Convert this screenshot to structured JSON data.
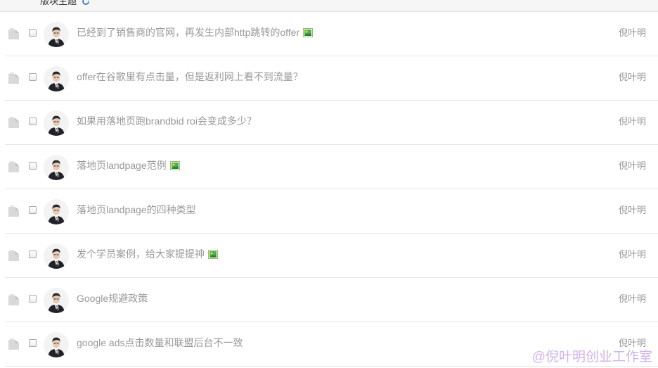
{
  "header": {
    "title": "版块主题",
    "refresh_icon": "refresh-icon"
  },
  "colors": {
    "title_text": "#999999",
    "author_text": "#999999",
    "divider": "#e6e6e6",
    "image_icon_green": "#4caf50",
    "image_icon_yellow": "#f3d34a",
    "watermark": "#cdaae8"
  },
  "topics": [
    {
      "title": "已经到了销售商的官网，再发生内部http跳转的offer",
      "has_image": true,
      "author": "倪叶明"
    },
    {
      "title": "offer在谷歌里有点击量，但是返利网上看不到流量？",
      "has_image": false,
      "author": "倪叶明"
    },
    {
      "title": "如果用落地页跑brandbid roi会变成多少？",
      "has_image": false,
      "author": "倪叶明"
    },
    {
      "title": "落地页landpage范例",
      "has_image": true,
      "author": "倪叶明"
    },
    {
      "title": "落地页landpage的四种类型",
      "has_image": false,
      "author": "倪叶明"
    },
    {
      "title": "发个学员案例，给大家提提神",
      "has_image": true,
      "author": "倪叶明"
    },
    {
      "title": "Google规避政策",
      "has_image": false,
      "author": "倪叶明"
    },
    {
      "title": "google ads点击数量和联盟后台不一致",
      "has_image": false,
      "author": "倪叶明"
    }
  ],
  "watermark": "@倪叶明创业工作室"
}
